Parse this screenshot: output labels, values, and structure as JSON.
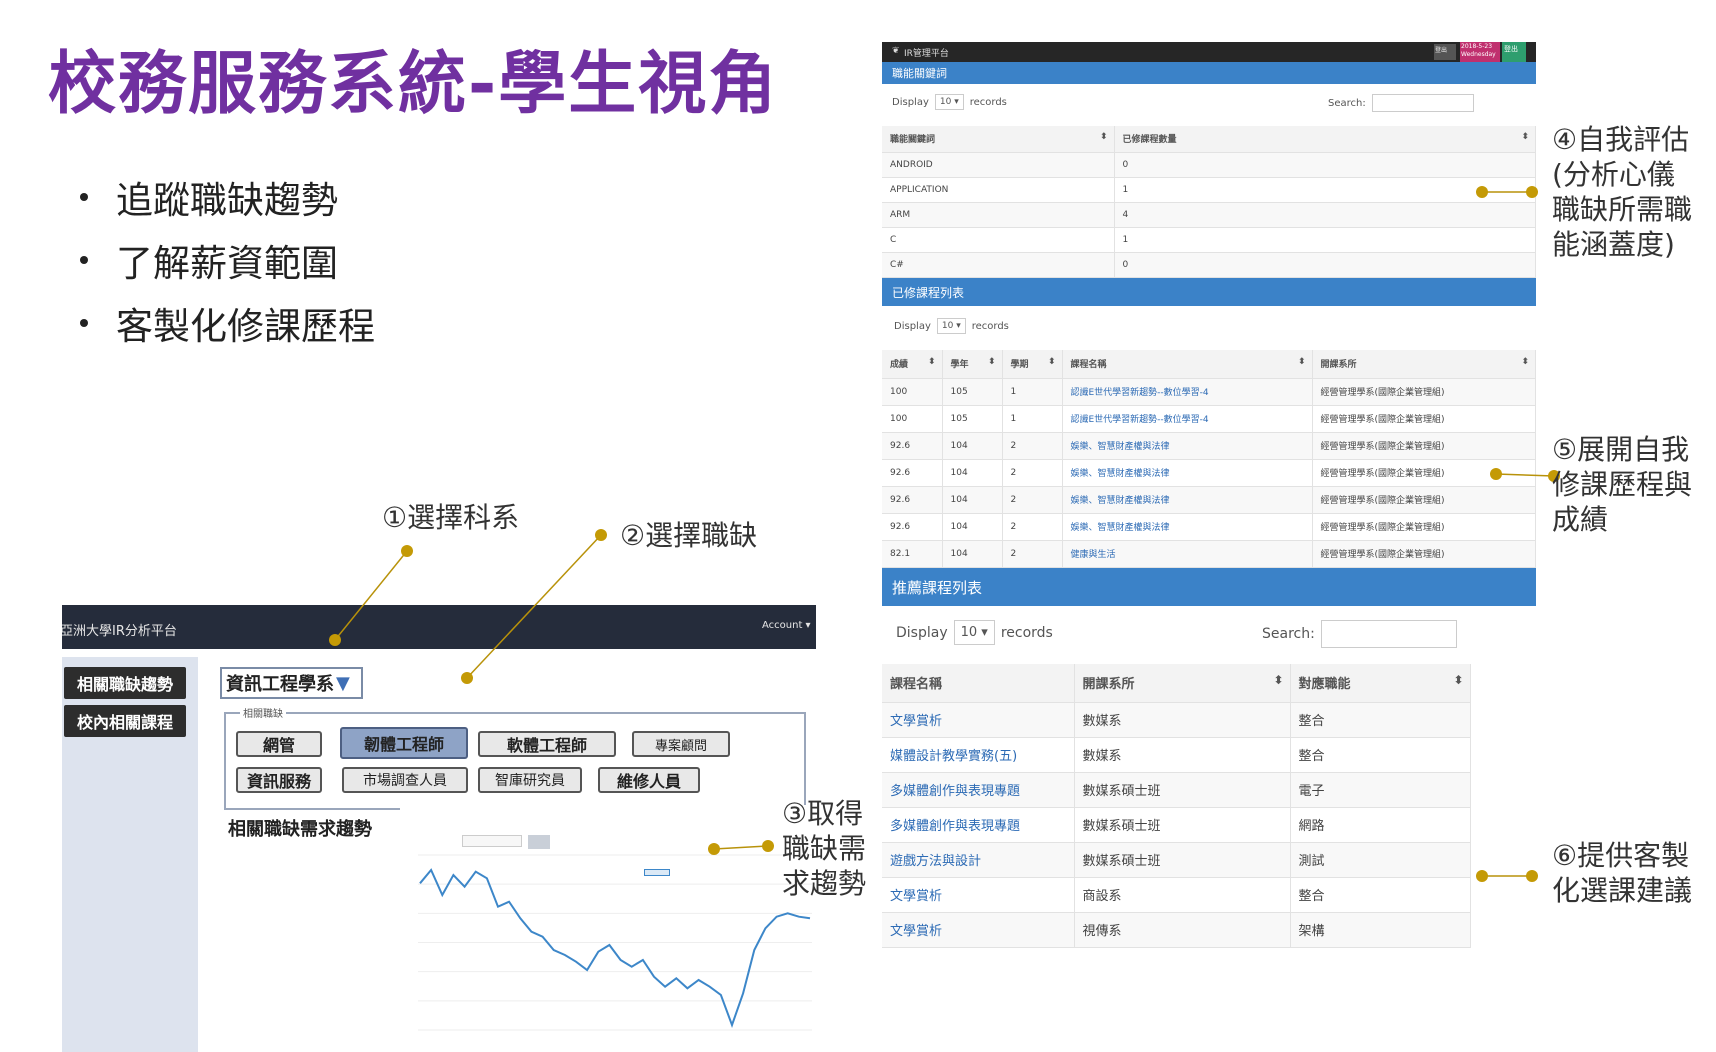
{
  "slide": {
    "title": "校務服務系統-學生視角",
    "bullets": [
      "追蹤職缺趨勢",
      "了解薪資範圍",
      "客製化修課歷程"
    ]
  },
  "callouts": {
    "c1": "①選擇科系",
    "c2": "②選擇職缺",
    "c3": [
      "③取得",
      "職缺需",
      "求趨勢"
    ],
    "c4": [
      "④自我評估",
      "(分析心儀",
      "職缺所需職",
      "能涵蓋度)"
    ],
    "c5": [
      "⑤展開自我",
      "修課歷程與",
      "成績"
    ],
    "c6": [
      "⑥提供客製",
      "化選課建議"
    ]
  },
  "left_app": {
    "brand": "亞洲大學IR分析平台",
    "account": "Account ▾",
    "side_buttons": [
      "相關職缺趨勢",
      "校內相關課程"
    ],
    "dept_select": "資訊工程學系",
    "fieldset_legend": "相關職缺",
    "jobs_row1": [
      "網管",
      "韌體工程師",
      "軟體工程師",
      "專案顧問"
    ],
    "jobs_row2": [
      "資訊服務",
      "市場調查人員",
      "智庫研究員",
      "維修人員"
    ],
    "demand_label": "相關職缺需求趨勢"
  },
  "chart_data": {
    "type": "line",
    "title": "",
    "series": [
      {
        "values": [
          1128,
          1136,
          1121,
          1133,
          1126,
          1135,
          1131,
          1114,
          1117,
          1107,
          1099,
          1096,
          1088,
          1085,
          1081,
          1076,
          1087,
          1091,
          1082,
          1078,
          1082,
          1072,
          1066,
          1071,
          1065,
          1070,
          1066,
          1061,
          1043,
          1062,
          1088,
          1101,
          1108,
          1110,
          1108,
          1107
        ]
      }
    ],
    "ylim": [
      1040,
      1145
    ]
  },
  "right_app": {
    "brand": "IR管理平台",
    "top_tags": [
      "登出",
      "2018-5-23 Wednesday",
      "登出"
    ],
    "panel1": {
      "title": "職能關鍵詞",
      "display": "Display",
      "records": "records",
      "page_size": "10",
      "search": "Search:",
      "headers": [
        "職能關鍵詞",
        "已修課程數量"
      ],
      "rows": [
        [
          "ANDROID",
          "0"
        ],
        [
          "APPLICATION",
          "1"
        ],
        [
          "ARM",
          "4"
        ],
        [
          "C",
          "1"
        ],
        [
          "C#",
          "0"
        ]
      ]
    },
    "panel2": {
      "title": "已修課程列表",
      "display": "Display",
      "records": "records",
      "page_size": "10",
      "headers": [
        "成績",
        "學年",
        "學期",
        "課程名稱",
        "開課系所"
      ],
      "rows": [
        [
          "100",
          "105",
          "1",
          "認識E世代學習新趨勢--數位學習-4",
          "經營管理學系(國際企業管理組)"
        ],
        [
          "100",
          "105",
          "1",
          "認識E世代學習新趨勢--數位學習-4",
          "經營管理學系(國際企業管理組)"
        ],
        [
          "92.6",
          "104",
          "2",
          "娛樂、智慧財產權與法律",
          "經營管理學系(國際企業管理組)"
        ],
        [
          "92.6",
          "104",
          "2",
          "娛樂、智慧財產權與法律",
          "經營管理學系(國際企業管理組)"
        ],
        [
          "92.6",
          "104",
          "2",
          "娛樂、智慧財產權與法律",
          "經營管理學系(國際企業管理組)"
        ],
        [
          "92.6",
          "104",
          "2",
          "娛樂、智慧財產權與法律",
          "經營管理學系(國際企業管理組)"
        ],
        [
          "82.1",
          "104",
          "2",
          "健康與生活",
          "經營管理學系(國際企業管理組)"
        ]
      ]
    },
    "panel3": {
      "title": "推薦課程列表",
      "display": "Display",
      "records": "records",
      "page_size": "10",
      "search": "Search:",
      "headers": [
        "課程名稱",
        "開課系所",
        "對應職能"
      ],
      "rows": [
        [
          "文學賞析",
          "數媒系",
          "整合"
        ],
        [
          "媒體設計教學實務(五)",
          "數媒系",
          "整合"
        ],
        [
          "多媒體創作與表現專題",
          "數媒系碩士班",
          "電子"
        ],
        [
          "多媒體創作與表現專題",
          "數媒系碩士班",
          "網路"
        ],
        [
          "遊戲方法與設計",
          "數媒系碩士班",
          "測試"
        ],
        [
          "文學賞析",
          "商設系",
          "整合"
        ],
        [
          "文學賞析",
          "視傳系",
          "架構"
        ]
      ]
    }
  }
}
